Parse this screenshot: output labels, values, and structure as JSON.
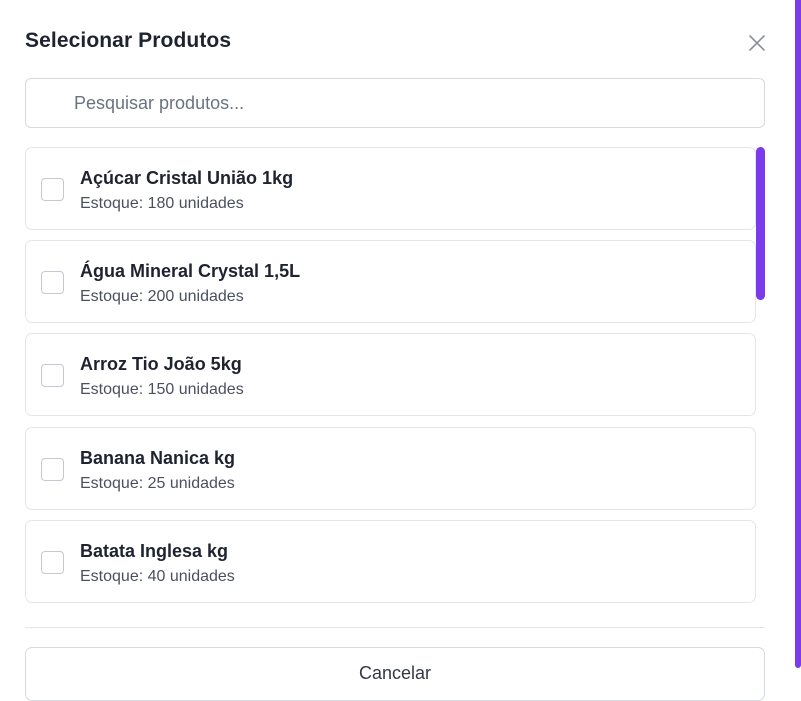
{
  "modal": {
    "title": "Selecionar Produtos",
    "close_icon": "close-icon"
  },
  "search": {
    "placeholder": "Pesquisar produtos...",
    "value": ""
  },
  "products": [
    {
      "name": "Açúcar Cristal União 1kg",
      "stock": "Estoque: 180 unidades",
      "checked": false
    },
    {
      "name": "Água Mineral Crystal 1,5L",
      "stock": "Estoque: 200 unidades",
      "checked": false
    },
    {
      "name": "Arroz Tio João 5kg",
      "stock": "Estoque: 150 unidades",
      "checked": false
    },
    {
      "name": "Banana Nanica kg",
      "stock": "Estoque: 25 unidades",
      "checked": false
    },
    {
      "name": "Batata Inglesa kg",
      "stock": "Estoque: 40 unidades",
      "checked": false
    }
  ],
  "footer": {
    "cancel_label": "Cancelar"
  },
  "colors": {
    "accent": "#7c3aed",
    "border": "#e3e5ea",
    "text": "#1f2330"
  }
}
